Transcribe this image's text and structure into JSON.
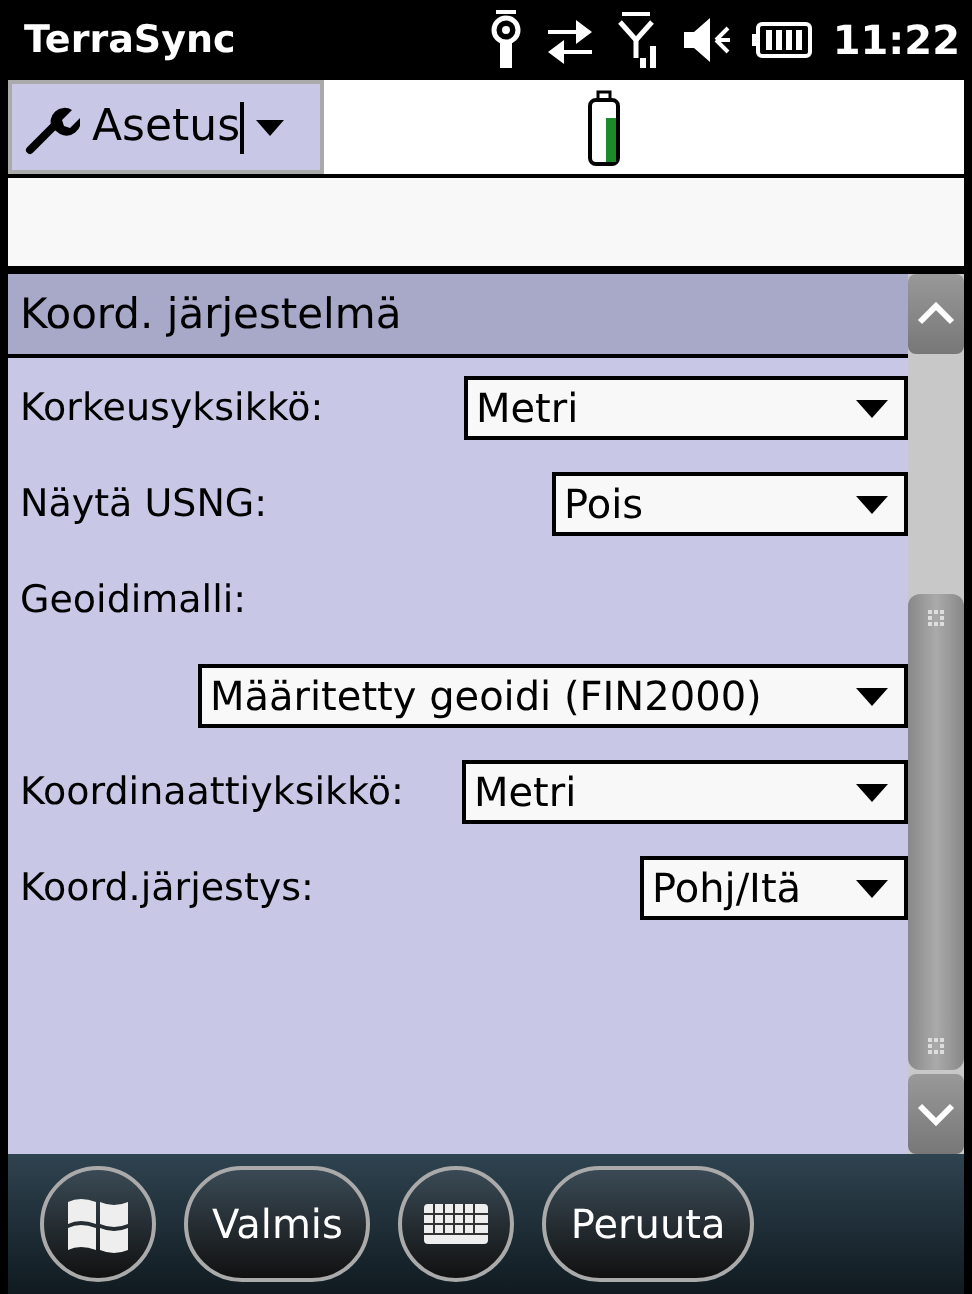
{
  "status_bar": {
    "title": "TerraSync",
    "time": "11:22"
  },
  "toolbar": {
    "menu_label": "Asetus"
  },
  "section": {
    "title": "Koord. järjestelmä"
  },
  "settings": [
    {
      "kind": "inline",
      "label": "Korkeusyksikkö:",
      "value": "Metri"
    },
    {
      "kind": "inline",
      "label": "Näytä USNG:",
      "value": "Pois"
    },
    {
      "kind": "stacked",
      "label": "Geoidimalli:",
      "value": "Määritetty geoidi (FIN2000)"
    },
    {
      "kind": "inline",
      "label": "Koordinaattiyksikkö:",
      "value": "Metri"
    },
    {
      "kind": "inline",
      "label": "Koord.järjestys:",
      "value": "Pohj/Itä"
    }
  ],
  "softkeys": {
    "left": "Valmis",
    "right": "Peruuta"
  }
}
